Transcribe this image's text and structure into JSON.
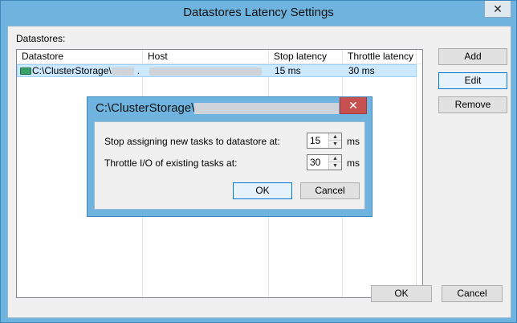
{
  "window": {
    "title": "Datastores Latency Settings",
    "close_glyph": "✕"
  },
  "datastores_label": "Datastores:",
  "table": {
    "headers": [
      "Datastore",
      "Host",
      "Stop latency",
      "Throttle latency"
    ],
    "rows": [
      {
        "datastore": "C:\\ClusterStorage\\",
        "datastore_suffix": ".",
        "host": "",
        "stop_latency": "15 ms",
        "throttle_latency": "30 ms"
      }
    ]
  },
  "side_buttons": {
    "add": "Add",
    "edit": "Edit",
    "remove": "Remove"
  },
  "footer_buttons": {
    "ok": "OK",
    "cancel": "Cancel"
  },
  "dialog": {
    "title": "C:\\ClusterStorage\\",
    "close_glyph": "✕",
    "stop_label": "Stop assigning new tasks to datastore at:",
    "stop_value": "15",
    "throttle_label": "Throttle I/O of existing tasks at:",
    "throttle_value": "30",
    "unit": "ms",
    "ok": "OK",
    "cancel": "Cancel"
  }
}
